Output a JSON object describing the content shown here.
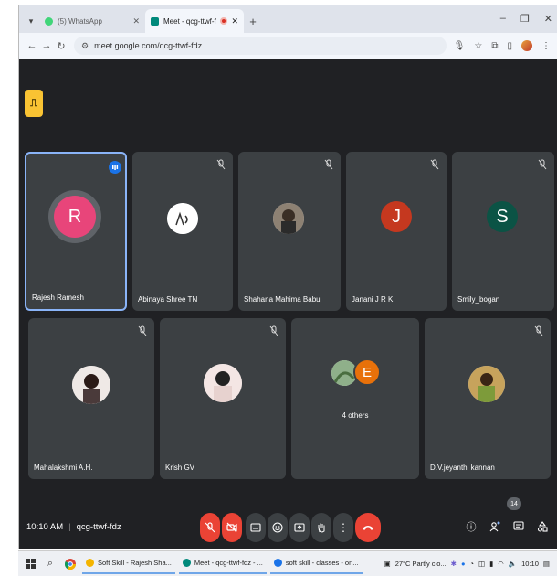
{
  "browser": {
    "tabs": [
      {
        "title": "(5) WhatsApp",
        "active": false,
        "color": "#25d366"
      },
      {
        "title": "Meet - qcg-ttwf-fdz",
        "active": true,
        "color": "#00897b"
      }
    ],
    "url": "meet.google.com/qcg-ttwf-fdz"
  },
  "meet": {
    "participants": [
      {
        "name": "Rajesh Ramesh",
        "initial": "R",
        "color": "#e8457a",
        "speaking": true
      },
      {
        "name": "Abinaya Shree TN",
        "avatar": "photo",
        "muted": true
      },
      {
        "name": "Shahana Mahima Babu",
        "avatar": "photo",
        "muted": true
      },
      {
        "name": "Janani J R K",
        "initial": "J",
        "color": "#c5381f",
        "muted": true
      },
      {
        "name": "Smily_bogan",
        "initial": "S",
        "color": "#0b5345",
        "muted": true
      },
      {
        "name": "Mahalakshmi A.H.",
        "avatar": "photo",
        "muted": true
      },
      {
        "name": "Krish GV",
        "avatar": "photo",
        "muted": true
      },
      {
        "name": "4 others",
        "initial": "E",
        "color": "#e8710a"
      },
      {
        "name": "D.V.jeyanthi kannan",
        "avatar": "photo",
        "muted": true
      }
    ],
    "time": "10:10 AM",
    "meeting_code": "qcg-ttwf-fdz",
    "people_count": "14"
  },
  "taskbar": {
    "apps": [
      {
        "label": "Soft Skill - Rajesh Sha...",
        "color": "#f4b400"
      },
      {
        "label": "Meet - qcg-ttwf-fdz - ...",
        "color": "#00897b"
      },
      {
        "label": "soft skill - classes - on...",
        "color": "#1a73e8"
      }
    ],
    "weather": "27°C Partly clo...",
    "clock": "10:10"
  },
  "colors": {
    "accent": "#8ab4f8",
    "end_call": "#ea4335",
    "meet_bg": "#202124"
  }
}
